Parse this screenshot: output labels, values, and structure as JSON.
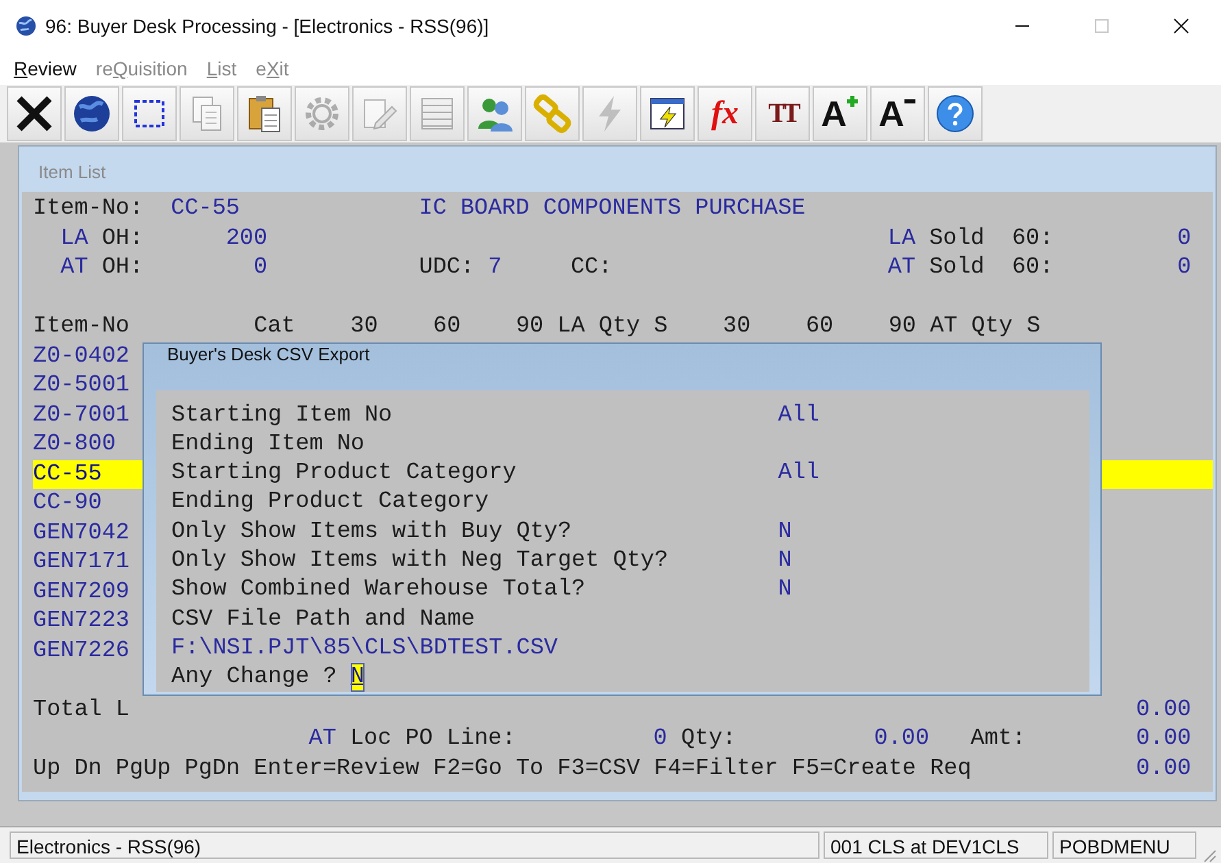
{
  "window": {
    "title": "96: Buyer Desk Processing - [Electronics - RSS(96)]",
    "controls": [
      {
        "kind": "minimize",
        "disabled": false
      },
      {
        "kind": "maximize",
        "disabled": true
      },
      {
        "kind": "close",
        "disabled": false
      }
    ]
  },
  "menu": [
    {
      "key": "R",
      "after": "eview",
      "disabled": false
    },
    {
      "before": "re",
      "key": "Q",
      "after": "uisition",
      "disabled": true
    },
    {
      "key": "L",
      "after": "ist",
      "disabled": true
    },
    {
      "before": "e",
      "key": "X",
      "after": "it",
      "disabled": true
    }
  ],
  "toolbar": [
    {
      "kind": "close",
      "disabled": false
    },
    {
      "kind": "globe",
      "disabled": false
    },
    {
      "kind": "select",
      "disabled": false
    },
    {
      "kind": "copy",
      "disabled": true
    },
    {
      "kind": "paste",
      "disabled": false
    },
    {
      "kind": "gear",
      "disabled": true
    },
    {
      "kind": "edit",
      "disabled": true
    },
    {
      "kind": "list",
      "disabled": true
    },
    {
      "kind": "users",
      "disabled": false
    },
    {
      "kind": "link",
      "disabled": false
    },
    {
      "kind": "bolt",
      "disabled": true
    },
    {
      "kind": "window-bolt",
      "disabled": false
    },
    {
      "kind": "fx",
      "glyph": "fx",
      "disabled": false
    },
    {
      "kind": "tt",
      "glyph": "TT",
      "disabled": false
    },
    {
      "kind": "font-up",
      "glyph": "A",
      "disabled": false
    },
    {
      "kind": "font-down",
      "glyph": "A",
      "disabled": false
    },
    {
      "kind": "help",
      "disabled": false
    }
  ],
  "item_list": {
    "title": "Item List",
    "item_no_label": "Item-No:",
    "item_no": "CC-55",
    "description": "IC BOARD COMPONENTS PURCHASE",
    "stock": [
      {
        "warehouse": "LA",
        "oh_label": "OH:",
        "oh": "200",
        "sold_warehouse": "LA",
        "sold_label": "Sold  60:",
        "sold": "0"
      },
      {
        "warehouse": "AT",
        "oh_label": "OH:",
        "oh": "0",
        "udc_label": "UDC:",
        "udc": "7",
        "cc_label": "CC:",
        "sold_warehouse": "AT",
        "sold_label": "Sold  60:",
        "sold": "0"
      }
    ],
    "header": "Item-No         Cat    30    60    90 LA Qty S    30    60    90 AT Qty S",
    "rows": [
      {
        "item": "Z0-0402",
        "selected": false
      },
      {
        "item": "Z0-5001",
        "selected": false
      },
      {
        "item": "Z0-7001",
        "selected": false
      },
      {
        "item": "Z0-800",
        "selected": false
      },
      {
        "item": "CC-55",
        "selected": true
      },
      {
        "item": "CC-90",
        "selected": false
      },
      {
        "item": "GEN7042",
        "selected": false
      },
      {
        "item": "GEN7171",
        "selected": false
      },
      {
        "item": "GEN7209",
        "selected": false
      },
      {
        "item": "GEN7223",
        "selected": false
      },
      {
        "item": "GEN7226",
        "selected": false
      }
    ],
    "total_label": "Total L",
    "total_amount": "0.00",
    "po_line": {
      "warehouse": "AT",
      "label": "Loc PO Line:",
      "line": "0",
      "qty_label": "Qty:",
      "qty": "0.00",
      "amt_label": "Amt:",
      "amt": "0.00"
    },
    "keys": "Up Dn PgUp PgDn Enter=Review F2=Go To F3=CSV F4=Filter F5=Create Req",
    "keys_amount": "0.00"
  },
  "dialog": {
    "title": "Buyer's Desk CSV Export",
    "fields": [
      {
        "label": "Starting Item No",
        "value": "All"
      },
      {
        "label": "Ending Item No"
      },
      {
        "label": "Starting Product Category",
        "value": "All"
      },
      {
        "label": "Ending Product Category"
      },
      {
        "label": "Only Show Items with Buy Qty?",
        "value": "N"
      },
      {
        "label": "Only Show Items with Neg Target Qty?",
        "value": "N"
      },
      {
        "label": "Show Combined Warehouse Total?",
        "value": "N"
      },
      {
        "label": "CSV File Path and Name"
      }
    ],
    "path": "F:\\NSI.PJT\\85\\CLS\\BDTEST.CSV",
    "prompt": "Any Change ?",
    "answer": "N"
  },
  "status_bar": [
    "Electronics - RSS(96)",
    "001 CLS at DEV1CLS",
    "POBDMENU"
  ]
}
